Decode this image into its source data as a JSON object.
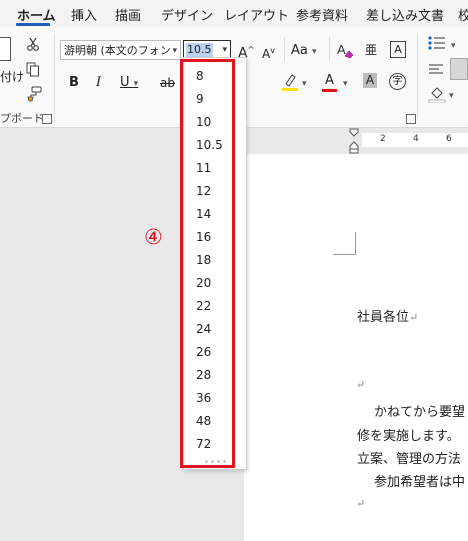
{
  "ribbon_tabs": [
    "ホーム",
    "挿入",
    "描画",
    "デザイン",
    "レイアウト",
    "参考資料",
    "差し込み文書",
    "校"
  ],
  "active_tab": "ホーム",
  "clipboard": {
    "paste_label": "付け",
    "group_label": "プボード"
  },
  "font": {
    "family_value": "游明朝 (本文のフォン",
    "size_value": "10.5",
    "bold": "B",
    "italic": "I",
    "underline": "U",
    "strike": "ab",
    "grow": "A",
    "shrink": "A",
    "case": "Aa",
    "clear_format_icon": "eraser-icon",
    "phonetic": "亜",
    "border_char": "A",
    "highlight_color": "#ffe400",
    "font_color": "#e0141e",
    "shade_char": "A",
    "enclose_char": "字"
  },
  "ruler_numbers": [
    "2",
    "4",
    "6",
    "8"
  ],
  "size_options": [
    "8",
    "9",
    "10",
    "10.5",
    "11",
    "12",
    "14",
    "16",
    "18",
    "20",
    "22",
    "24",
    "26",
    "28",
    "36",
    "48",
    "72"
  ],
  "annotation": {
    "step_label": "④",
    "color": "#e0141e"
  },
  "document": {
    "line1": "社員各位",
    "line3": "かねてから要望",
    "line4": "修を実施します。",
    "line5": "立案、管理の方法",
    "line6": "参加希望者は中"
  },
  "paragraph_mark": "↵"
}
